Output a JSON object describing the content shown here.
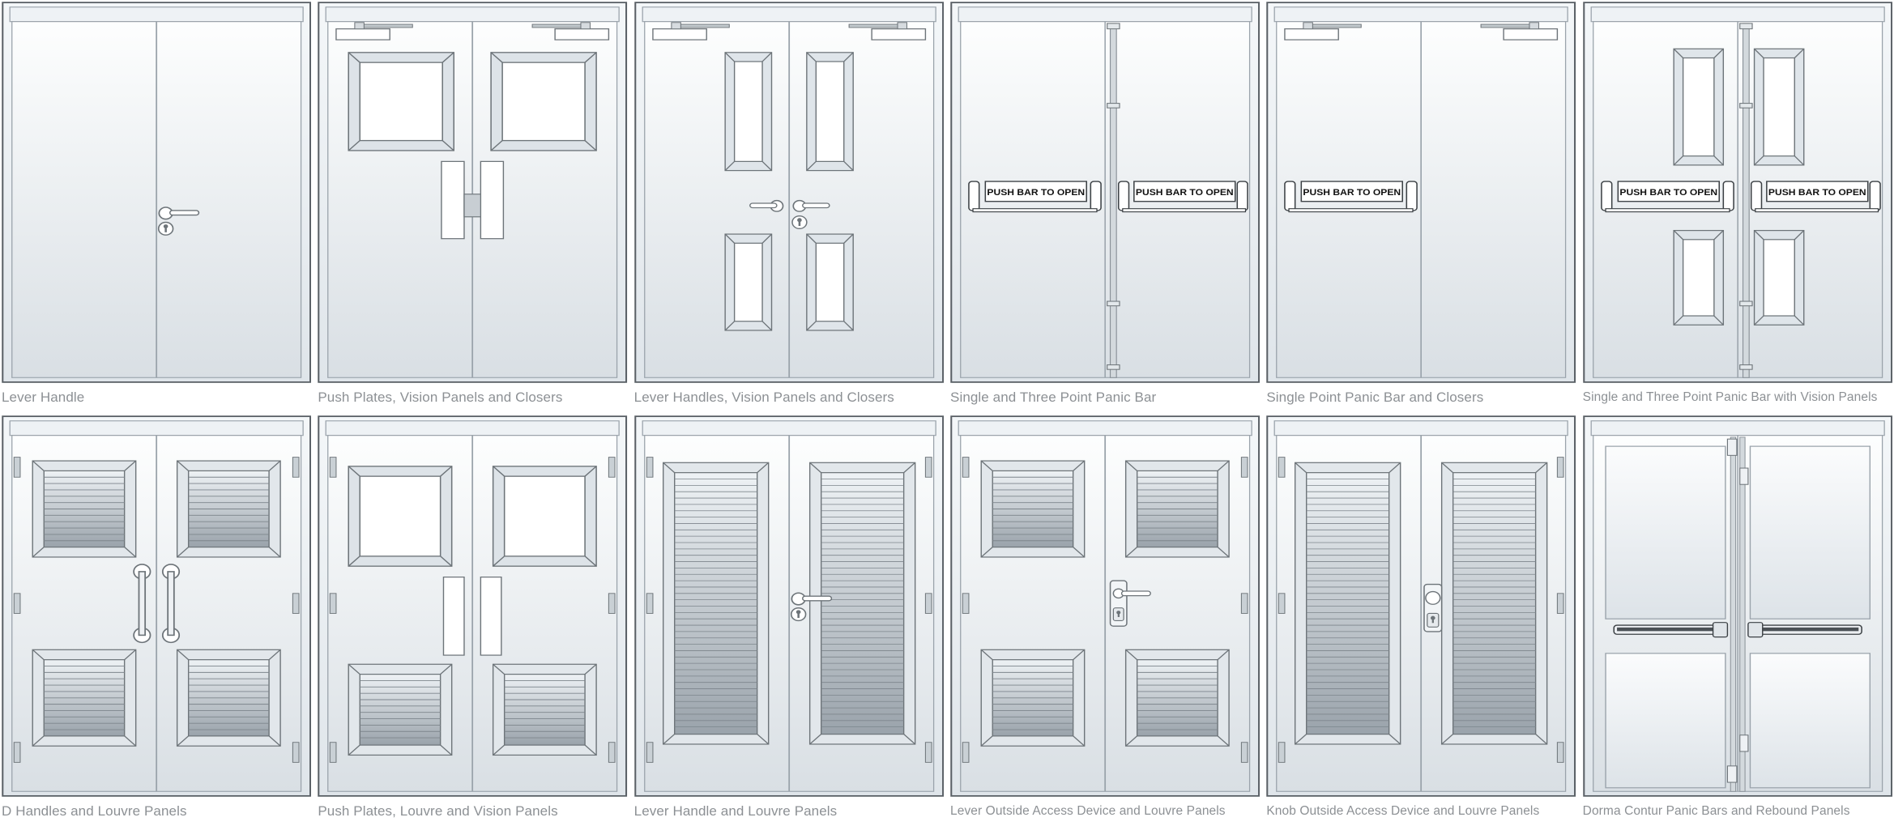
{
  "page": {
    "background_color": "#ffffff",
    "caption_color": "#8c9094",
    "rows": 2,
    "columns": 6,
    "total_figures": 12
  },
  "labels": {
    "push_bar_text": "PUSH BAR TO OPEN"
  },
  "figures": [
    {
      "index": 1,
      "caption": "Lever Handle",
      "row": 1,
      "column": 1,
      "leaves": 2,
      "hardware": [
        "lever-handle",
        "cylinder-lock"
      ],
      "panels": "none",
      "closers": false
    },
    {
      "index": 2,
      "caption": "Push Plates, Vision Panels and Closers",
      "row": 1,
      "column": 2,
      "leaves": 2,
      "hardware": [
        "push-plate",
        "push-plate",
        "door-closer",
        "door-closer"
      ],
      "panels": "square-vision-top",
      "closers": true
    },
    {
      "index": 3,
      "caption": "Lever Handles, Vision Panels and Closers",
      "row": 1,
      "column": 3,
      "leaves": 2,
      "hardware": [
        "lever-handle",
        "lever-handle",
        "cylinder-lock",
        "door-closer",
        "door-closer"
      ],
      "panels": "tall-vision-top-bottom",
      "closers": true
    },
    {
      "index": 4,
      "caption": "Single and Three Point Panic Bar",
      "row": 1,
      "column": 4,
      "leaves": 2,
      "hardware": [
        "panic-bar",
        "panic-bar",
        "three-point-rod"
      ],
      "panels": "none",
      "closers": false
    },
    {
      "index": 5,
      "caption": "Single Point Panic Bar and Closers",
      "row": 1,
      "column": 5,
      "leaves": 2,
      "hardware": [
        "panic-bar",
        "door-closer",
        "door-closer"
      ],
      "panels": "none",
      "closers": true
    },
    {
      "index": 6,
      "caption": "Single and Three Point Panic Bar with Vision Panels",
      "row": 1,
      "column": 6,
      "leaves": 2,
      "hardware": [
        "panic-bar",
        "panic-bar",
        "three-point-rod"
      ],
      "panels": "tall-vision-top-bottom",
      "closers": false
    },
    {
      "index": 7,
      "caption": "D Handles and Louvre Panels",
      "row": 2,
      "column": 1,
      "leaves": 2,
      "hardware": [
        "d-handle",
        "d-handle",
        "hinge"
      ],
      "panels": "louvre-top-bottom",
      "closers": false
    },
    {
      "index": 8,
      "caption": "Push Plates, Louvre and Vision Panels",
      "row": 2,
      "column": 2,
      "leaves": 2,
      "hardware": [
        "push-plate",
        "push-plate",
        "hinge"
      ],
      "panels": "vision-top-louvre-bottom",
      "closers": false
    },
    {
      "index": 9,
      "caption": "Lever Handle and Louvre Panels",
      "row": 2,
      "column": 3,
      "leaves": 2,
      "hardware": [
        "lever-handle",
        "cylinder-lock",
        "hinge"
      ],
      "panels": "full-height-louvre",
      "closers": false
    },
    {
      "index": 10,
      "caption": "Lever Outside Access Device and Louvre Panels",
      "row": 2,
      "column": 4,
      "leaves": 2,
      "hardware": [
        "lever-outside-access-device",
        "hinge"
      ],
      "panels": "louvre-top-bottom",
      "closers": false
    },
    {
      "index": 11,
      "caption": "Knob Outside Access Device and Louvre Panels",
      "row": 2,
      "column": 5,
      "leaves": 2,
      "hardware": [
        "knob-outside-access-device",
        "hinge"
      ],
      "panels": "full-height-louvre",
      "closers": false
    },
    {
      "index": 12,
      "caption": "Dorma Contur Panic Bars and Rebound Panels",
      "row": 2,
      "column": 6,
      "leaves": 2,
      "hardware": [
        "contur-panic-bar",
        "contur-panic-bar",
        "three-point-rod"
      ],
      "panels": "rebound-glazed",
      "closers": false
    }
  ]
}
